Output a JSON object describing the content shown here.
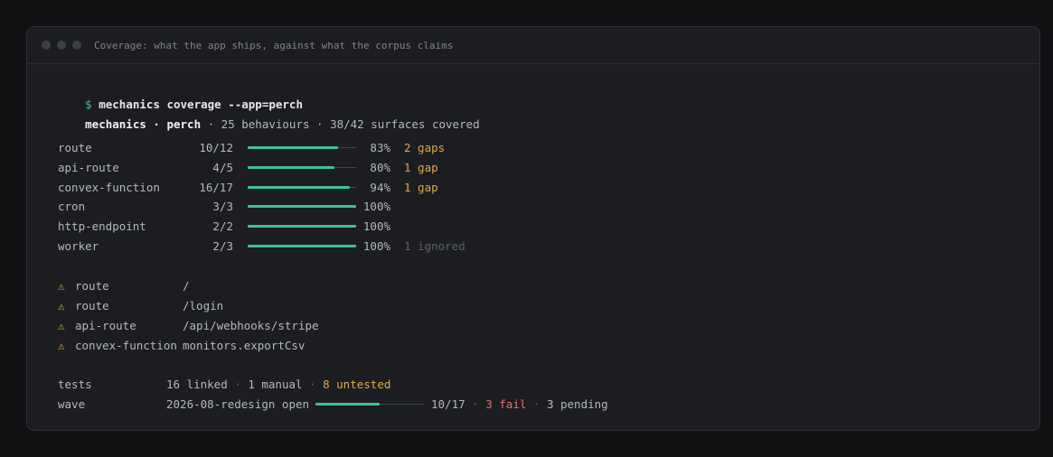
{
  "window": {
    "title": "Coverage: what the app ships, against what the corpus claims"
  },
  "command": {
    "prompt": "$",
    "text": "mechanics coverage --app=perch"
  },
  "summary": {
    "app": "mechanics · perch",
    "rest": " · 25 behaviours · 38/42 surfaces covered"
  },
  "coverage_rows": [
    {
      "kind": "route",
      "count": "10/12",
      "fraction": 0.83,
      "pct": "83%",
      "note": "2 gaps",
      "note_type": "warn"
    },
    {
      "kind": "api-route",
      "count": "4/5",
      "fraction": 0.8,
      "pct": "80%",
      "note": "1 gap",
      "note_type": "warn"
    },
    {
      "kind": "convex-function",
      "count": "16/17",
      "fraction": 0.94,
      "pct": "94%",
      "note": "1 gap",
      "note_type": "warn"
    },
    {
      "kind": "cron",
      "count": "3/3",
      "fraction": 1.0,
      "pct": "100%",
      "note": "",
      "note_type": ""
    },
    {
      "kind": "http-endpoint",
      "count": "2/2",
      "fraction": 1.0,
      "pct": "100%",
      "note": "",
      "note_type": ""
    },
    {
      "kind": "worker",
      "count": "2/3",
      "fraction": 1.0,
      "pct": "100%",
      "note": "1 ignored",
      "note_type": "dim"
    }
  ],
  "gaps": [
    {
      "icon": "warning-icon",
      "glyph": "⚠",
      "kind": "route",
      "path": "/"
    },
    {
      "icon": "warning-icon",
      "glyph": "⚠",
      "kind": "route",
      "path": "/login"
    },
    {
      "icon": "warning-icon",
      "glyph": "⚠",
      "kind": "api-route",
      "path": "/api/webhooks/stripe"
    },
    {
      "icon": "warning-icon",
      "glyph": "⚠",
      "kind": "convex-function",
      "path": "monitors.exportCsv"
    }
  ],
  "tests": {
    "label": "tests",
    "linked": "16 linked",
    "sep1": " · ",
    "manual": "1 manual",
    "sep2": " · ",
    "untested": "8 untested"
  },
  "wave": {
    "label": "wave",
    "name": "2026-08-redesign open",
    "fraction": 0.5882,
    "count": "10/17",
    "sep1": " · ",
    "fail": "3 fail",
    "sep2": " · ",
    "pending": "3 pending"
  },
  "colors": {
    "accent": "#3fbf9f",
    "warn": "#e0a84a",
    "fail": "#e0706b",
    "dim": "#5c6068"
  }
}
